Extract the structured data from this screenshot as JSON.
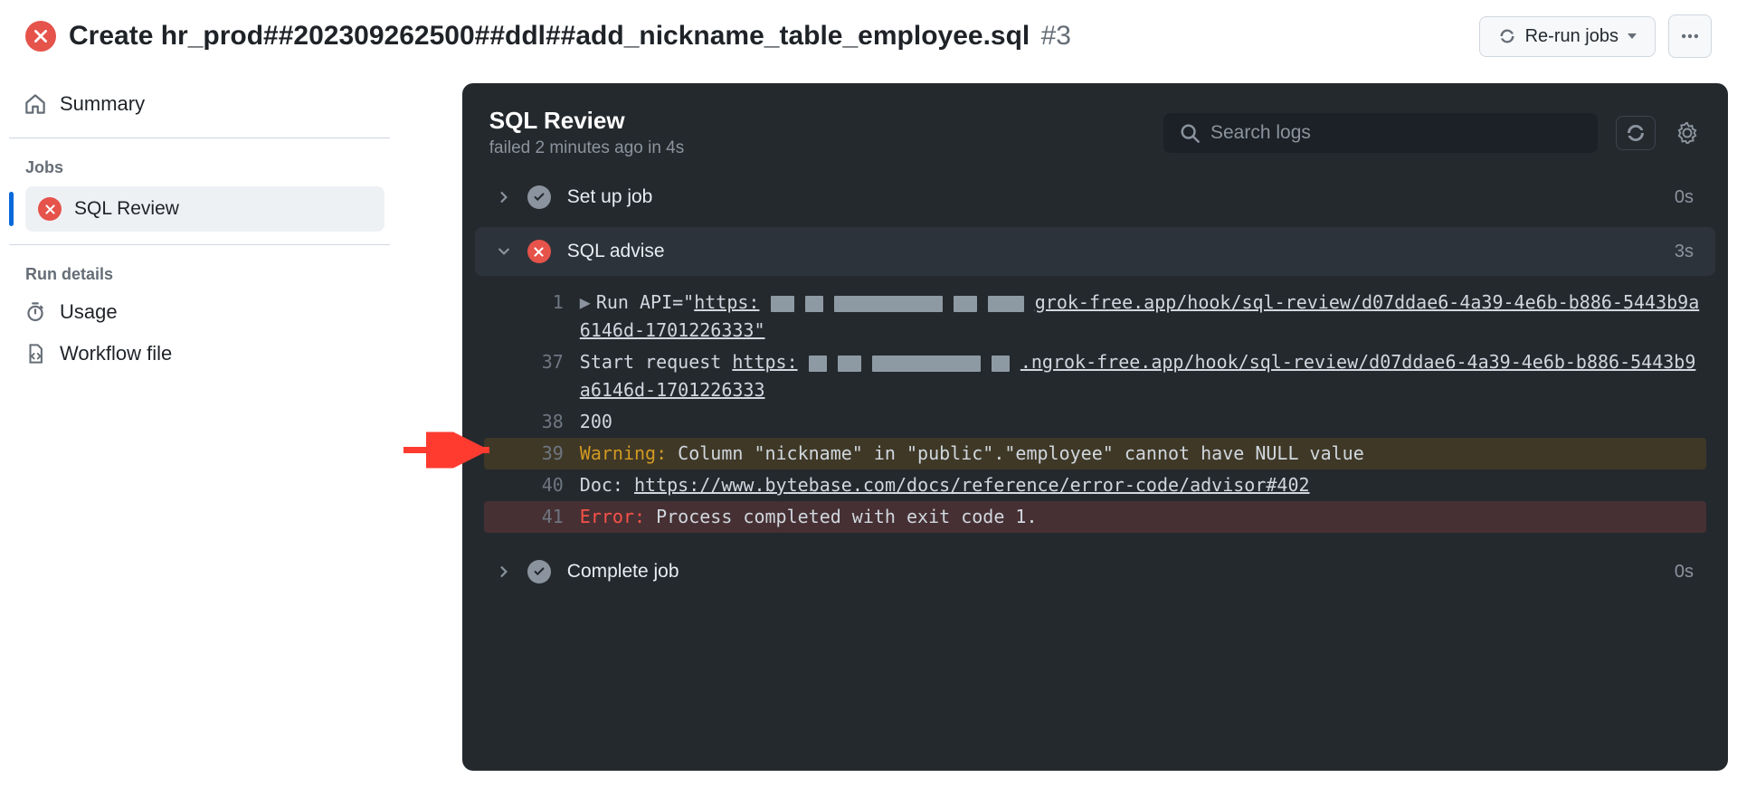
{
  "header": {
    "status": "failed",
    "title": "Create hr_prod##202309262500##ddl##add_nickname_table_employee.sql",
    "run_number": "#3",
    "rerun_label": "Re-run jobs"
  },
  "sidebar": {
    "summary_label": "Summary",
    "jobs_heading": "Jobs",
    "jobs": [
      {
        "name": "SQL Review",
        "status": "failed",
        "active": true
      }
    ],
    "run_details_heading": "Run details",
    "usage_label": "Usage",
    "workflow_file_label": "Workflow file"
  },
  "panel": {
    "title": "SQL Review",
    "sub_status": "failed 2 minutes ago in 4s",
    "search_placeholder": "Search logs",
    "steps": [
      {
        "id": "setup",
        "name": "Set up job",
        "status": "success",
        "duration": "0s",
        "expanded": false
      },
      {
        "id": "advise",
        "name": "SQL advise",
        "status": "failed",
        "duration": "3s",
        "expanded": true
      },
      {
        "id": "complete",
        "name": "Complete job",
        "status": "success",
        "duration": "0s",
        "expanded": false
      }
    ],
    "log": {
      "lines": [
        {
          "n": 1,
          "kind": "run",
          "prefix": "Run API=\"",
          "url": "https:",
          "mid_redacted": true,
          "tail": "grok-free.app/hook/sql-review/d07ddae6-4a39-4e6b-b886-5443b9a6146d-1701226333\""
        },
        {
          "n": 37,
          "kind": "plain",
          "prefix": "Start request ",
          "url": "https:",
          "mid_redacted": true,
          "tail": ".ngrok-free.app/hook/sql-review/d07ddae6-4a39-4e6b-b886-5443b9a6146d-1701226333"
        },
        {
          "n": 38,
          "kind": "plain",
          "text": "200"
        },
        {
          "n": 39,
          "kind": "warning",
          "label": "Warning:",
          "text": " Column \"nickname\" in \"public\".\"employee\" cannot have NULL value"
        },
        {
          "n": 40,
          "kind": "plain",
          "prefix": "Doc: ",
          "url": "https://www.bytebase.com/docs/reference/error-code/advisor#402"
        },
        {
          "n": 41,
          "kind": "error",
          "label": "Error:",
          "text": " Process completed with exit code 1."
        }
      ]
    }
  }
}
